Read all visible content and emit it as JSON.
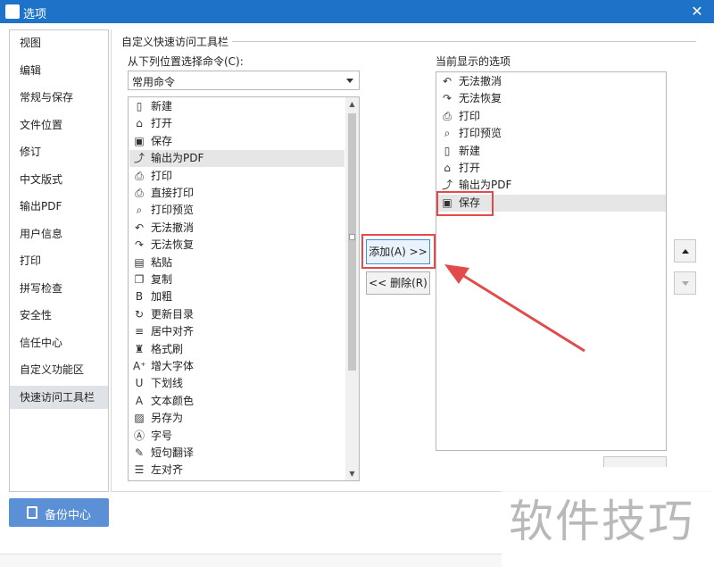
{
  "window": {
    "title": "选项",
    "close_glyph": "✕"
  },
  "nav": {
    "items": [
      {
        "label": "视图"
      },
      {
        "label": "编辑"
      },
      {
        "label": "常规与保存"
      },
      {
        "label": "文件位置"
      },
      {
        "label": "修订"
      },
      {
        "label": "中文版式"
      },
      {
        "label": "输出PDF"
      },
      {
        "label": "用户信息"
      },
      {
        "label": "打印"
      },
      {
        "label": "拼写检查"
      },
      {
        "label": "安全性"
      },
      {
        "label": "信任中心"
      },
      {
        "label": "自定义功能区"
      },
      {
        "label": "快速访问工具栏"
      }
    ],
    "active": "快速访问工具栏",
    "backup_label": "备份中心"
  },
  "qat": {
    "group_title": "自定义快速访问工具栏",
    "choose_label": "从下列位置选择命令(C):",
    "combo_value": "常用命令",
    "current_label": "当前显示的选项",
    "add_label": "添加(A) >>",
    "remove_label": "<< 删除(R)",
    "left_items": [
      {
        "label": "新建",
        "icon": "new-doc-icon",
        "glyph": "▯"
      },
      {
        "label": "打开",
        "icon": "folder-icon",
        "glyph": "⌂"
      },
      {
        "label": "保存",
        "icon": "save-icon",
        "glyph": "▣"
      },
      {
        "label": "输出为PDF",
        "icon": "pdf-export-icon",
        "glyph": "⤴"
      },
      {
        "label": "打印",
        "icon": "print-icon",
        "glyph": "⎙"
      },
      {
        "label": "直接打印",
        "icon": "direct-print-icon",
        "glyph": "⎙"
      },
      {
        "label": "打印预览",
        "icon": "print-preview-icon",
        "glyph": "⌕"
      },
      {
        "label": "无法撤消",
        "icon": "undo-icon",
        "glyph": "↶"
      },
      {
        "label": "无法恢复",
        "icon": "redo-icon",
        "glyph": "↷"
      },
      {
        "label": "粘贴",
        "icon": "paste-icon",
        "glyph": "▤"
      },
      {
        "label": "复制",
        "icon": "copy-icon",
        "glyph": "❐"
      },
      {
        "label": "加粗",
        "icon": "bold-icon",
        "glyph": "B"
      },
      {
        "label": "更新目录",
        "icon": "update-toc-icon",
        "glyph": "↻"
      },
      {
        "label": "居中对齐",
        "icon": "align-center-icon",
        "glyph": "≡"
      },
      {
        "label": "格式刷",
        "icon": "format-painter-icon",
        "glyph": "♜"
      },
      {
        "label": "增大字体",
        "icon": "grow-font-icon",
        "glyph": "A⁺"
      },
      {
        "label": "下划线",
        "icon": "underline-icon",
        "glyph": "U"
      },
      {
        "label": "文本颜色",
        "icon": "text-color-icon",
        "glyph": "A"
      },
      {
        "label": "另存为",
        "icon": "save-as-icon",
        "glyph": "▨"
      },
      {
        "label": "字号",
        "icon": "font-size-icon",
        "glyph": "Ⓐ"
      },
      {
        "label": "短句翻译",
        "icon": "translate-icon",
        "glyph": "✎"
      },
      {
        "label": "左对齐",
        "icon": "align-left-icon",
        "glyph": "☰"
      }
    ],
    "left_selected": "输出为PDF",
    "right_items": [
      {
        "label": "无法撤消",
        "icon": "undo-icon",
        "glyph": "↶"
      },
      {
        "label": "无法恢复",
        "icon": "redo-icon",
        "glyph": "↷"
      },
      {
        "label": "打印",
        "icon": "print-icon",
        "glyph": "⎙"
      },
      {
        "label": "打印预览",
        "icon": "print-preview-icon",
        "glyph": "⌕"
      },
      {
        "label": "新建",
        "icon": "new-doc-icon",
        "glyph": "▯"
      },
      {
        "label": "打开",
        "icon": "folder-icon",
        "glyph": "⌂"
      },
      {
        "label": "输出为PDF",
        "icon": "pdf-export-icon",
        "glyph": "⤴"
      },
      {
        "label": "保存",
        "icon": "save-icon",
        "glyph": "▣"
      }
    ],
    "right_selected": "保存"
  },
  "watermark": {
    "text": "软件技巧"
  },
  "colors": {
    "titlebar": "#1e73c8",
    "backup_button": "#5b8fd6",
    "highlight": "#e14b4b"
  }
}
